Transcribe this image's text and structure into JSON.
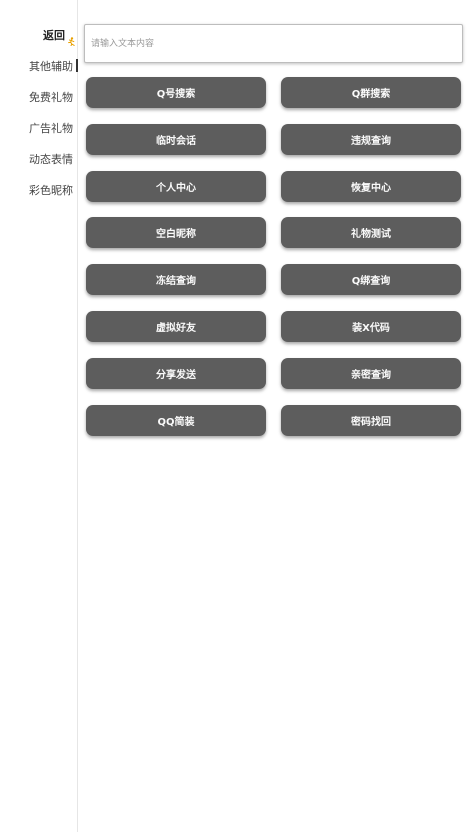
{
  "sidebar": {
    "back_label": "返回",
    "back_icon": "running-figure-icon",
    "items": [
      {
        "label": "其他辅助",
        "active": true
      },
      {
        "label": "免费礼物"
      },
      {
        "label": "广告礼物"
      },
      {
        "label": "动态表情"
      },
      {
        "label": "彩色昵称"
      }
    ]
  },
  "search": {
    "placeholder": "请输入文本内容",
    "value": ""
  },
  "buttons": [
    "Q号搜索",
    "Q群搜索",
    "临时会话",
    "违规查询",
    "个人中心",
    "恢复中心",
    "空白昵称",
    "礼物测试",
    "冻结查询",
    "Q绑查询",
    "虚拟好友",
    "装X代码",
    "分享发送",
    "亲密查询",
    "QQ简装",
    "密码找回"
  ],
  "colors": {
    "button_bg": "#5d5d5d",
    "button_text": "#fafafa",
    "accent": "#e8a000"
  }
}
